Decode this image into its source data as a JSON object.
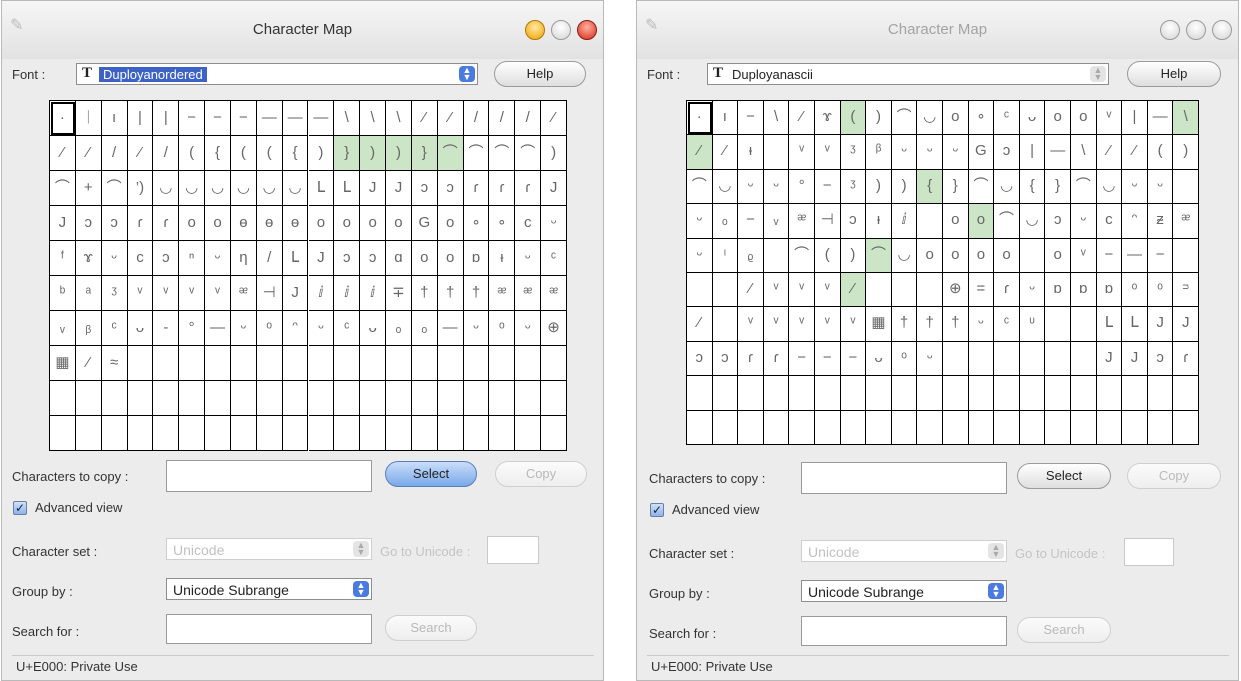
{
  "windows": [
    {
      "title": "Character Map",
      "font_label": "Font :",
      "font_name": "Duployanordered",
      "font_icon": "T",
      "help_label": "Help",
      "chars_to_copy_label": "Characters to copy :",
      "chars_to_copy_value": "",
      "select_label": "Select",
      "copy_label": "Copy",
      "advanced_view_label": "Advanced view",
      "advanced_view_checked": "✓",
      "character_set_label": "Character set :",
      "character_set_value": "Unicode",
      "goto_unicode_label": "Go to Unicode :",
      "goto_unicode_value": "",
      "group_by_label": "Group by :",
      "group_by_value": "Unicode Subrange",
      "search_for_label": "Search for :",
      "search_value": "",
      "search_button_label": "Search",
      "status": "U+E000: Private Use",
      "grid": {
        "rows": 10,
        "cols": 20,
        "selected_index": 0,
        "highlight_indices": [
          31,
          32,
          33,
          34,
          35
        ],
        "glyphs": [
          "·",
          "ᛁ",
          "ı",
          "|",
          "|",
          "−",
          "−",
          "−",
          "—",
          "—",
          "—",
          "\\",
          "\\",
          "\\",
          "⁄",
          "⁄",
          "/",
          "/",
          "/",
          "⁄",
          "⁄",
          "⁄",
          "/",
          "⁄",
          "/",
          "(",
          "{",
          "(",
          "(",
          "{",
          ")",
          "}",
          ")",
          ")",
          "}",
          "⌒",
          "⌒",
          "⌒",
          "⌒",
          ")",
          "⌒",
          "+",
          "⌒",
          "’)",
          "◡",
          "◡",
          "◡",
          "◡",
          "◡",
          "◡",
          "ᒪ",
          "ᒪ",
          "J",
          "J",
          "ↄ",
          "ↄ",
          "ɾ",
          "ɾ",
          "ɾ",
          "J",
          "J",
          "ↄ",
          "ↄ",
          "ɾ",
          "ɾ",
          "o",
          "o",
          "ɵ",
          "ɵ",
          "ɵ",
          "o",
          "o",
          "o",
          "o",
          "G",
          "o",
          "∘",
          "∘",
          "c",
          "ᵕ",
          "ᶠ",
          "ɤ",
          "ᵕ",
          "c",
          "ↄ",
          "ⁿ",
          "ᵕ",
          "ƞ",
          "/",
          "ᒪ",
          "J",
          "ↄ",
          "ↄ",
          "ɑ",
          "o",
          "o",
          "ɒ",
          "ᵼ",
          "ᵕ",
          "ᶜ",
          "ᵇ",
          "ᵃ",
          "ᶾ",
          "ᵛ",
          "ᵛ",
          "ᵛ",
          "ᵛ",
          "ᵆ",
          "⊣",
          "J",
          "ⅈ",
          "ⅈ",
          "ⅈ",
          "∓",
          "†",
          "†",
          "†",
          "ᵆ",
          "ᵆ",
          "ᵆ",
          "ᵥ",
          "ᵦ",
          "ᶜ",
          "ᴗ",
          "-",
          "°",
          "—",
          "ᵕ",
          "ᵒ",
          "ᵔ",
          "ᵕ",
          "ᶜ",
          "ᴗ",
          "ₒ",
          "ₒ",
          "—",
          "ᵕ",
          "ᵒ",
          "ᵕ",
          "⊕",
          "▦",
          "⁄",
          "≈",
          "",
          "",
          "",
          "",
          "",
          "",
          "",
          "",
          "",
          "",
          "",
          "",
          "",
          "",
          "",
          "",
          "",
          "",
          "",
          "",
          "",
          "",
          "",
          "",
          "",
          "",
          "",
          "",
          "",
          "",
          "",
          "",
          "",
          "",
          "",
          "",
          "",
          "",
          "",
          "",
          "",
          "",
          "",
          "",
          "",
          "",
          "",
          "",
          "",
          "",
          "",
          "",
          "",
          "",
          "",
          "",
          ""
        ]
      }
    },
    {
      "title": "Character Map",
      "font_label": "Font :",
      "font_name": "Duployanascii",
      "font_icon": "T",
      "help_label": "Help",
      "chars_to_copy_label": "Characters to copy :",
      "chars_to_copy_value": "",
      "select_label": "Select",
      "copy_label": "Copy",
      "advanced_view_label": "Advanced view",
      "advanced_view_checked": "✓",
      "character_set_label": "Character set :",
      "character_set_value": "Unicode",
      "goto_unicode_label": "Go to Unicode :",
      "goto_unicode_value": "",
      "group_by_label": "Group by :",
      "group_by_value": "Unicode Subrange",
      "search_for_label": "Search for :",
      "search_value": "",
      "search_button_label": "Search",
      "status": "U+E000: Private Use",
      "grid": {
        "rows": 10,
        "cols": 20,
        "selected_index": 0,
        "highlight_indices": [
          6,
          19,
          20,
          49,
          71,
          87,
          106
        ],
        "glyphs": [
          "·",
          "ı",
          "−",
          "\\",
          "⁄",
          "ɤ",
          "(",
          ")",
          "⌒",
          "◡",
          "o",
          "∘",
          "ᶜ",
          "ᴗ",
          "o",
          "o",
          "ᵛ",
          "|",
          "—",
          "\\",
          "⁄",
          "⁄",
          "ᵼ",
          "",
          "ᵛ",
          "ᵛ",
          "ᶾ",
          "ᵝ",
          "ᵕ",
          "ᵕ",
          "ᵕ",
          "G",
          "ɔ",
          "|",
          "—",
          "\\",
          "⁄",
          "⁄",
          "(",
          ")",
          "⌒",
          "◡",
          "ᵕ",
          "ᵕ",
          "°",
          "−",
          "ᶾ",
          ")",
          ")",
          "{",
          "}",
          "⌒",
          "◡",
          "{",
          "}",
          "⌒",
          "◡",
          "ᵕ",
          "ᵕ",
          "",
          "ᵕ",
          "ₒ",
          "−",
          "ᵥ",
          "ᵆ",
          "⊣",
          "ɔ",
          "ᵼ",
          "ⅈ",
          "",
          "o",
          "o",
          "⌒",
          "◡",
          "ɔ",
          "ᵕ",
          "c",
          "ᵔ",
          "ᵶ",
          "ᵆ",
          "ᵕ",
          "ᶦ",
          "ᵨ",
          "",
          "⌒",
          "(",
          ")",
          "⌒",
          "◡",
          "o",
          "o",
          "o",
          "o",
          "",
          "o",
          "ᵛ",
          "−",
          "—",
          "−",
          "",
          "",
          "",
          "⁄",
          "ᵛ",
          "ᵛ",
          "ᵛ",
          "⁄",
          "",
          "",
          "",
          "⊕",
          "=",
          "ɾ",
          "ᵕ",
          "ɒ",
          "ɒ",
          "ɒ",
          "ᵒ",
          "ᵒ",
          "ᵙ",
          "⁄",
          "",
          "ᵛ",
          "ᵛ",
          "ᵛ",
          "ᵛ",
          "ᵛ",
          "▦",
          "†",
          "†",
          "†",
          "ᵕ",
          "ᶜ",
          "ᶸ",
          "",
          "",
          "ᒪ",
          "ᒪ",
          "J",
          "J",
          "ↄ",
          "ↄ",
          "ɾ",
          "ɾ",
          "−",
          "−",
          "−",
          "ᴗ",
          "ᵒ",
          "ᵕ",
          "",
          "",
          "",
          "",
          "",
          "",
          "J",
          "J",
          "ↄ",
          "ɾ",
          "",
          "",
          "",
          "",
          "",
          "",
          "",
          "",
          "",
          "",
          "",
          "",
          "",
          "",
          "",
          "",
          "",
          "",
          "",
          "",
          "",
          "",
          "",
          "",
          "",
          "",
          "",
          "",
          "",
          "",
          "",
          "",
          "",
          "",
          "",
          "",
          "",
          "",
          "",
          ""
        ]
      }
    }
  ]
}
